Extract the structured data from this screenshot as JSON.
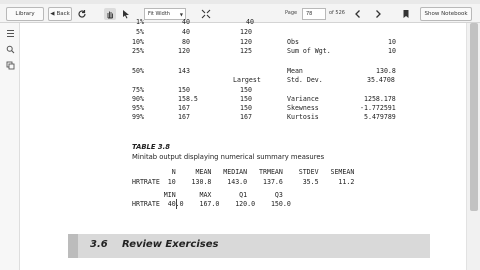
{
  "toolbar": {
    "library_label": "Library",
    "back_label": "Back",
    "zoom_value": "Fit Width",
    "page_label": "Page",
    "page_value": "78",
    "page_total": "of 526",
    "notebook_label": "Show Notebook"
  },
  "summary_rows": [
    {
      "pct": "1%",
      "a": "40",
      "b": "40",
      "label": "",
      "val": ""
    },
    {
      "pct": "5%",
      "a": "40",
      "b": "120",
      "label": "",
      "val": ""
    },
    {
      "pct": "10%",
      "a": "80",
      "b": "120",
      "label": "Obs",
      "val": "10"
    },
    {
      "pct": "25%",
      "a": "120",
      "b": "125",
      "label": "Sum of Wgt.",
      "val": "10"
    },
    {
      "pct": "50%",
      "a": "143",
      "b": "",
      "label": "Mean",
      "val": "130.8"
    },
    {
      "pct": "",
      "a": "",
      "b": "Largest",
      "label": "Std. Dev.",
      "val": "35.4708"
    },
    {
      "pct": "75%",
      "a": "150",
      "b": "150",
      "label": "",
      "val": ""
    },
    {
      "pct": "90%",
      "a": "158.5",
      "b": "150",
      "label": "Variance",
      "val": "1258.178"
    },
    {
      "pct": "95%",
      "a": "167",
      "b": "150",
      "label": "Skewness",
      "val": "-1.772591"
    },
    {
      "pct": "99%",
      "a": "167",
      "b": "167",
      "label": "Kurtosis",
      "val": "5.479789"
    }
  ],
  "table": {
    "caption": "TABLE 3.8",
    "subtitle": "Minitab output displaying numerical summary measures",
    "row1_header": "          N     MEAN   MEDIAN   TRMEAN    STDEV   SEMEAN",
    "row1_values": "HRTRATE  10    130.8    143.0    137.6     35.5     11.2",
    "row2_header": "        MIN      MAX       Q1       Q3",
    "row2_values": "HRTRATE  40.0    167.0    120.0    150.0"
  },
  "section": {
    "number": "3.6",
    "title": "Review Exercises"
  }
}
